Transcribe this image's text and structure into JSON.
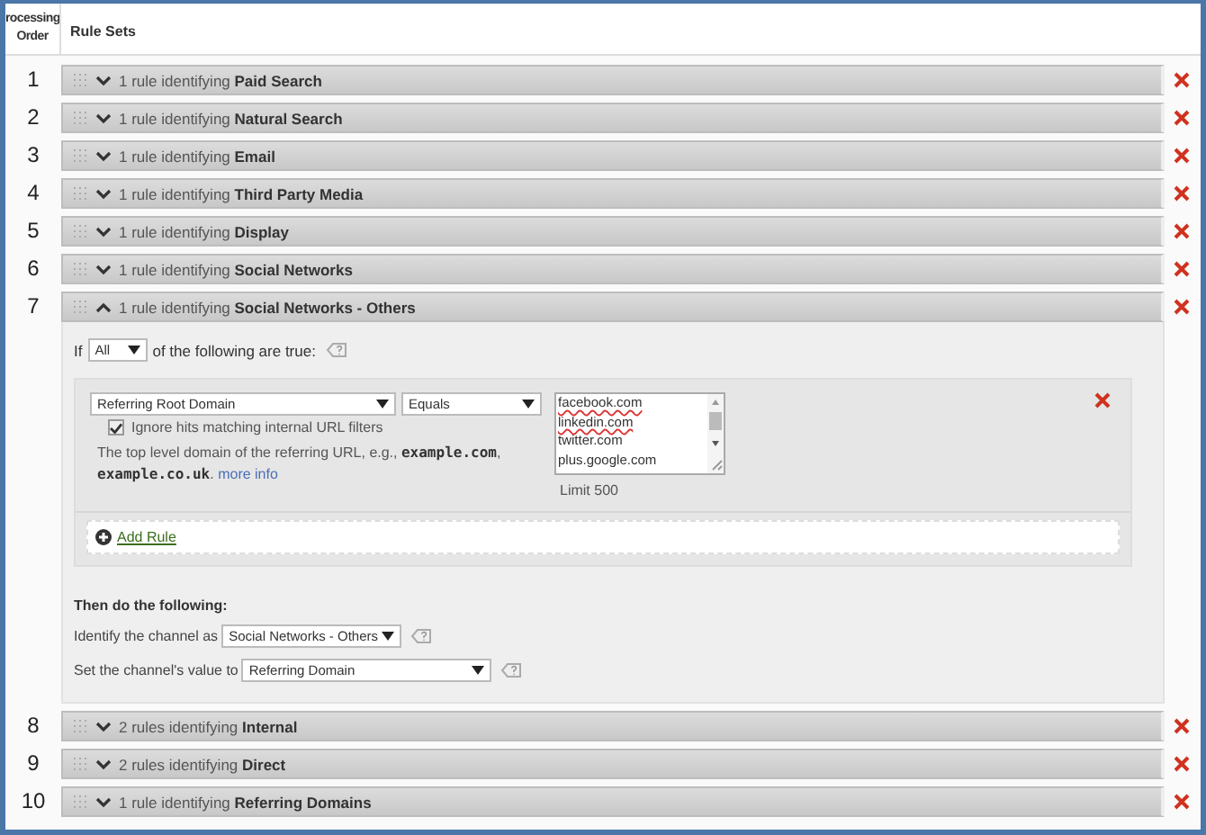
{
  "columns": [
    {
      "label": "rocessing Order"
    },
    {
      "label": "Rule Sets"
    }
  ],
  "rule_sets": [
    {
      "number": "1",
      "summary": "1 rule identifying",
      "channel": "Paid Search",
      "expanded": false
    },
    {
      "number": "2",
      "summary": "1 rule identifying",
      "channel": "Natural Search",
      "expanded": false
    },
    {
      "number": "3",
      "summary": "1 rule identifying",
      "channel": "Email",
      "expanded": false
    },
    {
      "number": "4",
      "summary": "1 rule identifying",
      "channel": "Third Party Media",
      "expanded": false
    },
    {
      "number": "5",
      "summary": "1 rule identifying",
      "channel": "Display",
      "expanded": false
    },
    {
      "number": "6",
      "summary": "1 rule identifying",
      "channel": "Social Networks",
      "expanded": false
    },
    {
      "number": "7",
      "summary": "1 rule identifying",
      "channel": "Social Networks - Others",
      "expanded": true,
      "detail": {
        "condition": {
          "prefix": "If",
          "match": "All",
          "suffix": "of the following are true:"
        },
        "rules": [
          {
            "dimension": "Referring Root Domain",
            "operator": "Equals",
            "values": [
              "facebook.com",
              "linkedin.com",
              "twitter.com",
              "plus.google.com"
            ],
            "limit": "Limit 500",
            "ignore_internal": {
              "label": "Ignore hits matching internal URL filters",
              "checked": true
            },
            "description": "The top level domain of the referring URL, e.g., **example.com**, **example.co.uk**.",
            "more_info": "more info"
          }
        ],
        "add_rule": "Add Rule",
        "actions": {
          "heading": "Then do the following:",
          "channel_label": "Identify the channel as",
          "channel_value": "Social Networks - Others",
          "value_label": "Set the channel's value to",
          "value_value": "Referring Domain"
        }
      }
    },
    {
      "number": "8",
      "summary": "2 rules identifying",
      "channel": "Internal",
      "expanded": false
    },
    {
      "number": "9",
      "summary": "2 rules identifying",
      "channel": "Direct",
      "expanded": false
    },
    {
      "number": "10",
      "summary": "1 rule identifying",
      "channel": "Referring Domains",
      "expanded": false
    }
  ]
}
